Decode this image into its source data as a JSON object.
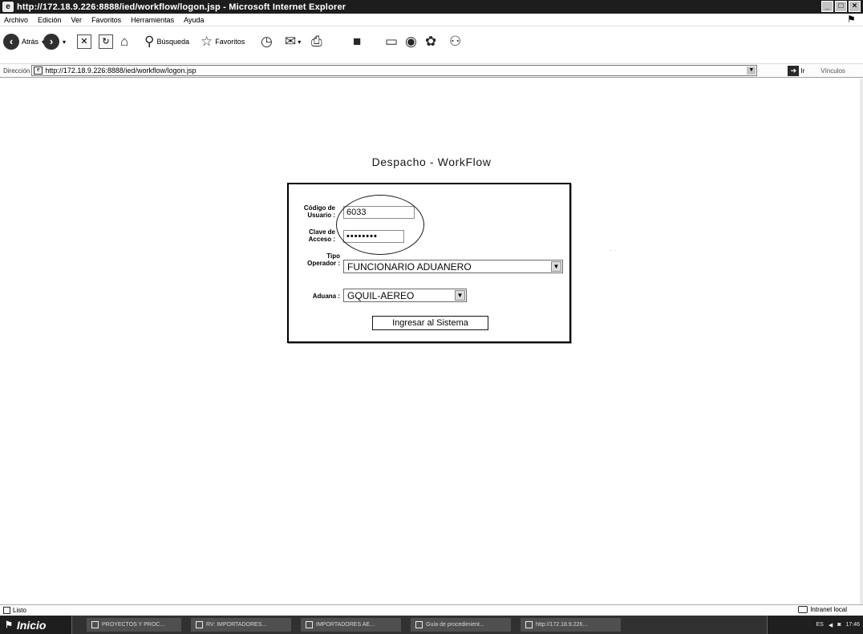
{
  "window": {
    "title": "http://172.18.9.226:8888/ied/workflow/logon.jsp - Microsoft Internet Explorer",
    "buttons": [
      "_",
      "□",
      "×"
    ]
  },
  "menu": [
    "Archivo",
    "Edición",
    "Ver",
    "Favoritos",
    "Herramientas",
    "Ayuda"
  ],
  "toolbar": {
    "back_label": "Atrás",
    "search_label": "Búsqueda",
    "favorites_label": "Favoritos"
  },
  "address": {
    "label": "Dirección",
    "url": "http://172.18.9.226:8888/ied/workflow/logon.jsp",
    "go_label": "Ir",
    "links_label": "Vínculos"
  },
  "page": {
    "heading": "Despacho - WorkFlow",
    "form": {
      "user_label_1": "Código de",
      "user_label_2": "Usuario :",
      "user_value": "6033",
      "password_label_1": "Clave de",
      "password_label_2": "Acceso :",
      "password_value": "••••••••",
      "operator_label_1": "Tipo",
      "operator_label_2": "Operador :",
      "operator_value": "FUNCIONARIO ADUANERO",
      "customs_label": "Aduana :",
      "customs_value": "GQUIL-AEREO",
      "submit_label": "Ingresar al Sistema"
    }
  },
  "status": {
    "text": "Listo",
    "zone": "Intranet local"
  },
  "taskbar": {
    "start_label": "Inicio",
    "tasks": [
      "PROYECTOS Y PROC...",
      "RV: IMPORTADORES...",
      "IMPORTADORES AE...",
      "Guía de procedimient...",
      "http://172.18.9.226..."
    ],
    "lang": "ES",
    "clock": "17:46"
  }
}
